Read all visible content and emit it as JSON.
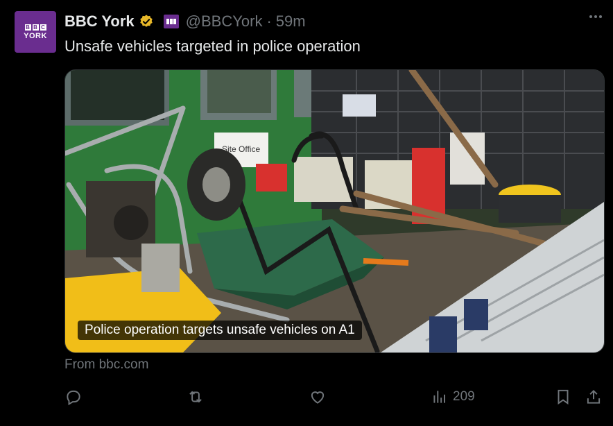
{
  "author": {
    "display_name": "BBC York",
    "handle": "@BBCYork",
    "separator": "·",
    "time": "59m",
    "avatar_logo": "BBC",
    "avatar_city": "YORK",
    "verified_color": "#e8b829",
    "brand_color": "#6a2d8f"
  },
  "tweet": {
    "text": "Unsafe vehicles targeted in police operation"
  },
  "card": {
    "image_caption": "Police operation targets unsafe vehicles on A1",
    "sign_text": "Site Office",
    "source": "From bbc.com"
  },
  "actions": {
    "reply_icon": "reply-icon",
    "retweet_icon": "retweet-icon",
    "like_icon": "heart-icon",
    "views_icon": "views-icon",
    "views_count": "209",
    "bookmark_icon": "bookmark-icon",
    "share_icon": "share-icon"
  }
}
